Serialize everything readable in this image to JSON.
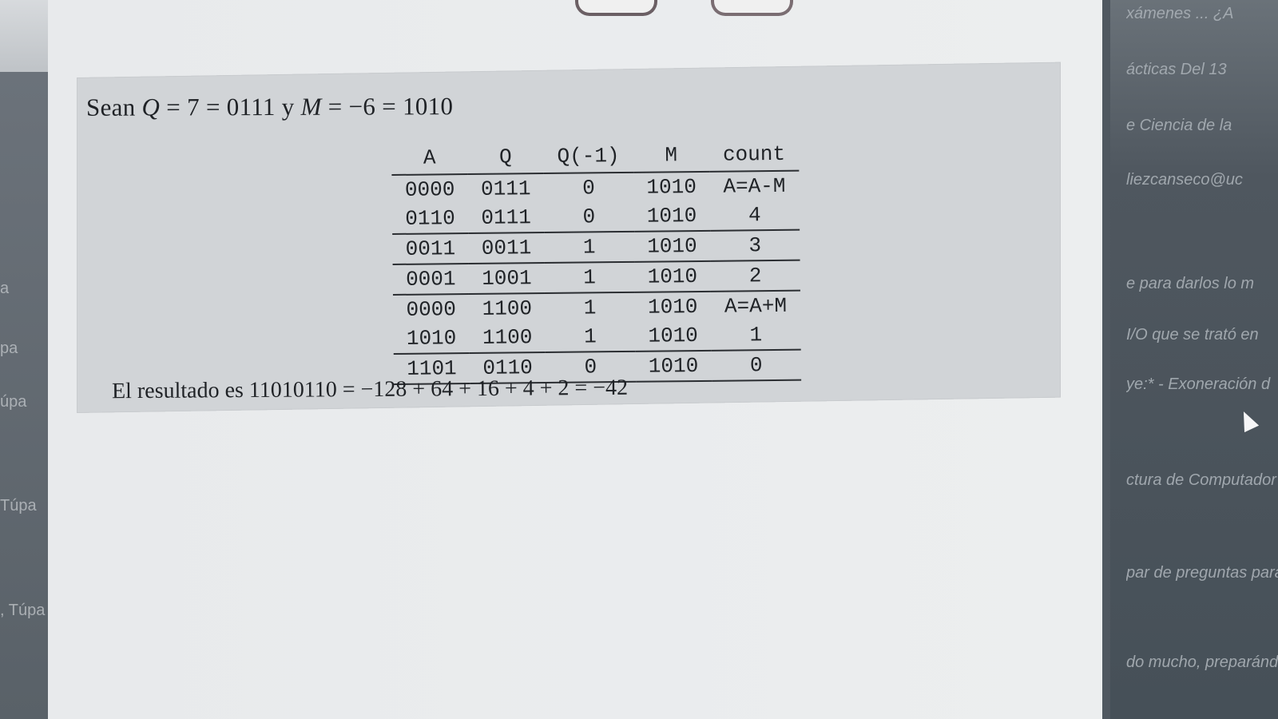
{
  "left_strip": {
    "items": [
      {
        "text": "a"
      },
      {
        "text": "pa"
      },
      {
        "text": "úpa"
      },
      {
        "text": "Túpa"
      },
      {
        "text": ", Túpa"
      }
    ]
  },
  "right_strip": {
    "items": [
      {
        "text": "xámenes ... ¿A"
      },
      {
        "text": "ácticas Del 13"
      },
      {
        "text": "e Ciencia de la"
      },
      {
        "text": "liezcanseco@uc"
      },
      {
        "text": "e para darlos lo m"
      },
      {
        "text": "I/O que se trató en"
      },
      {
        "text": "ye:* - Exoneración d"
      },
      {
        "text": "ctura de Computador"
      },
      {
        "text": "par de preguntas para q"
      },
      {
        "text": "do mucho, preparándose"
      }
    ]
  },
  "document": {
    "intro": {
      "prefix": "Sean ",
      "q_symbol": "Q",
      "q_value": " = 7 = 0111 y ",
      "m_symbol": "M",
      "m_value": " = −6 = 1010"
    },
    "table": {
      "headers": [
        "A",
        "Q",
        "Q(-1)",
        "M",
        "count"
      ],
      "rows": [
        [
          "0000",
          "0111",
          "0",
          "1010",
          "A=A-M"
        ],
        [
          "0110",
          "0111",
          "0",
          "1010",
          "4"
        ],
        [
          "0011",
          "0011",
          "1",
          "1010",
          "3"
        ],
        [
          "0001",
          "1001",
          "1",
          "1010",
          "2"
        ],
        [
          "0000",
          "1100",
          "1",
          "1010",
          "A=A+M"
        ],
        [
          "1010",
          "1100",
          "1",
          "1010",
          "1"
        ],
        [
          "1101",
          "0110",
          "0",
          "1010",
          "0"
        ]
      ],
      "separator_before_rows": [
        2,
        3,
        4,
        6
      ]
    },
    "result": "El resultado es 11010110 = −128 + 64 + 16 + 4 + 2 = −42"
  }
}
